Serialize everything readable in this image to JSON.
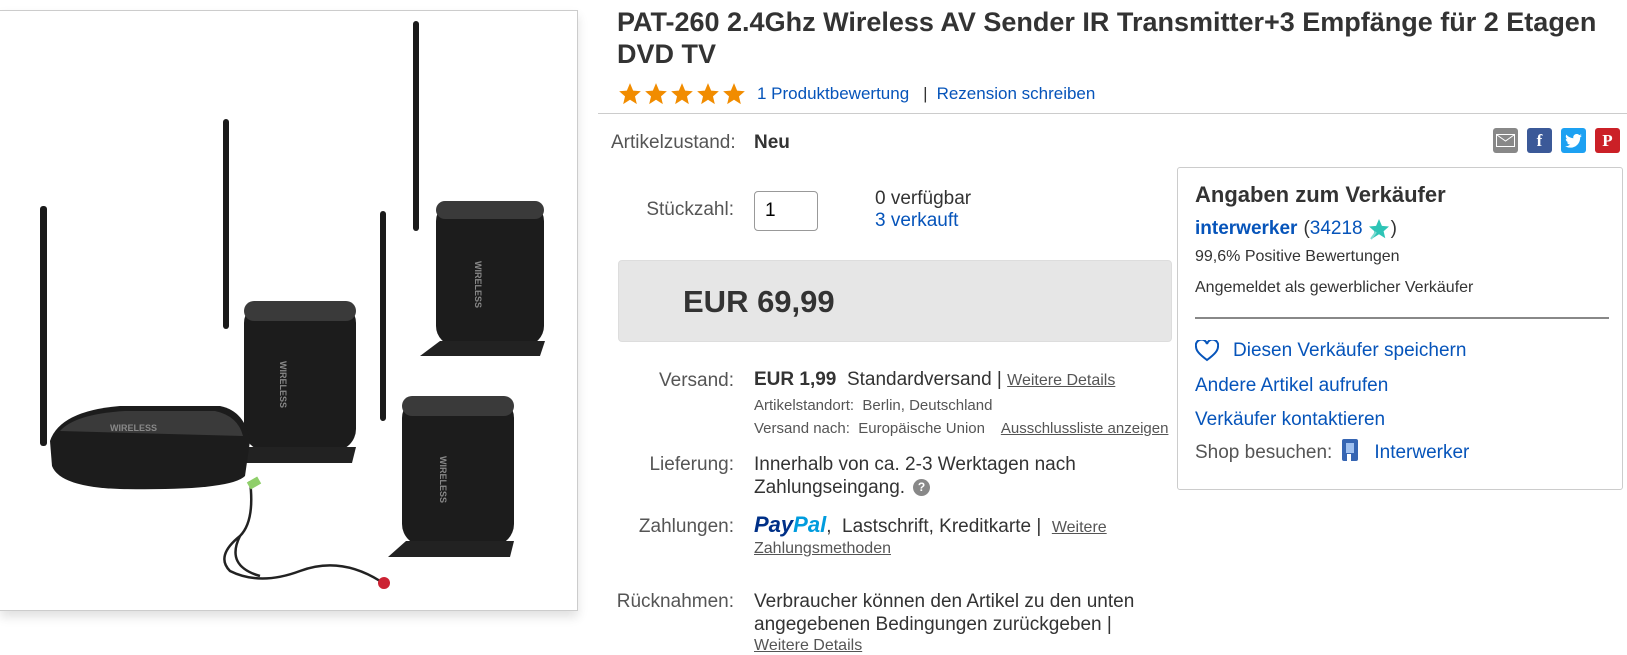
{
  "title": "PAT-260 2.4Ghz Wireless AV Sender IR Transmitter+3 Empfänge für 2 Etagen DVD TV",
  "rating": {
    "stars": 5,
    "reviews_link": "1 Produktbewertung",
    "separator": "|",
    "write_review": "Rezension schreiben",
    "star_color": "#f18c00"
  },
  "product_image": {
    "device_labels": [
      "WIRELESS",
      "WIRELESS",
      "WIRELESS",
      "WIRELESS"
    ]
  },
  "condition": {
    "label": "Artikelzustand:",
    "value": "Neu"
  },
  "quantity": {
    "label": "Stückzahl:",
    "value": "1",
    "available": "0 verfügbar",
    "sold": "3 verkauft"
  },
  "price": {
    "value": "EUR 69,99"
  },
  "shipping": {
    "label": "Versand:",
    "cost": "EUR 1,99",
    "method": "Standardversand |",
    "details_link": "Weitere Details",
    "location_label": "Artikelstandort:",
    "location": "Berlin, Deutschland",
    "ships_to_label": "Versand nach:",
    "ships_to": "Europäische Union",
    "exclusion_link": "Ausschlussliste anzeigen"
  },
  "delivery": {
    "label": "Lieferung:",
    "line1": "Innerhalb von ca. 2-3 Werktagen nach",
    "line2": "Zahlungseingang."
  },
  "payments": {
    "label": "Zahlungen:",
    "paypal_a": "Pay",
    "paypal_b": "Pal",
    "comma": ",",
    "methods": "Lastschrift,  Kreditkarte  |",
    "more_link_1": "Weitere",
    "more_link_2": "Zahlungsmethoden"
  },
  "returns": {
    "label": "Rücknahmen:",
    "line1": "Verbraucher können den Artikel zu den unten",
    "line2": "angegebenen Bedingungen zurückgeben |",
    "more_link": "Weitere Details"
  },
  "seller": {
    "heading": "Angaben zum Verkäufer",
    "name": "interwerker",
    "score_open": "(",
    "score": "34218",
    "score_close": ")",
    "feedback": "99,6% Positive Bewertungen",
    "type": "Angemeldet als gewerblicher Verkäufer",
    "save": "Diesen Verkäufer speichern",
    "other_items": "Andere Artikel aufrufen",
    "contact": "Verkäufer kontaktieren",
    "shop_label": "Shop besuchen:",
    "shop_name": "Interwerker"
  },
  "share_icons": [
    "email-icon",
    "facebook-icon",
    "twitter-icon",
    "pinterest-icon"
  ],
  "colors": {
    "link": "#0654ba",
    "facebook": "#3b5998",
    "twitter": "#1da1f2",
    "pinterest": "#cb2027",
    "paypal_dark": "#003087",
    "paypal_light": "#009cde"
  }
}
